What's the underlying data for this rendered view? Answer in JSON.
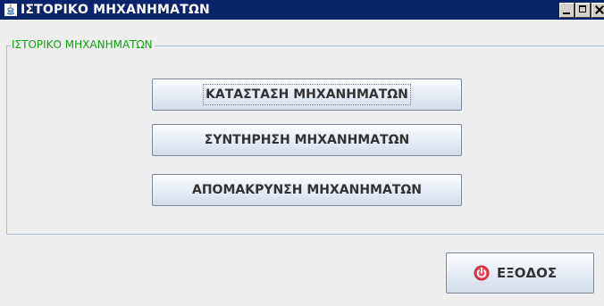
{
  "window": {
    "title": "ΙΣΤΟΡΙΚΟ ΜΗΧΑΝΗΜΑΤΩΝ",
    "app_icon": "java-icon",
    "controls": [
      "minimize-icon",
      "maximize-icon",
      "close-icon"
    ],
    "titlebar_color": "#0a246a"
  },
  "group": {
    "title": "ΙΣΤΟΡΙΚΟ ΜΗΧΑΝΗΜΑΤΩΝ",
    "title_color": "#12a012",
    "buttons": [
      {
        "label": "ΚΑΤΑΣΤΑΣΗ ΜΗΧΑΝΗΜΑΤΩΝ",
        "focused": true
      },
      {
        "label": "ΣΥΝΤΗΡΗΣΗ ΜΗΧΑΝΗΜΑΤΩΝ",
        "focused": false
      },
      {
        "label": "ΑΠΟΜΑΚΡΥΝΣΗ ΜΗΧΑΝΗΜΑΤΩΝ",
        "focused": false
      }
    ]
  },
  "footer": {
    "exit_label": "ΕΞΟΔΟΣ",
    "exit_icon": "exit-icon",
    "exit_icon_color": "#d42a3a"
  }
}
